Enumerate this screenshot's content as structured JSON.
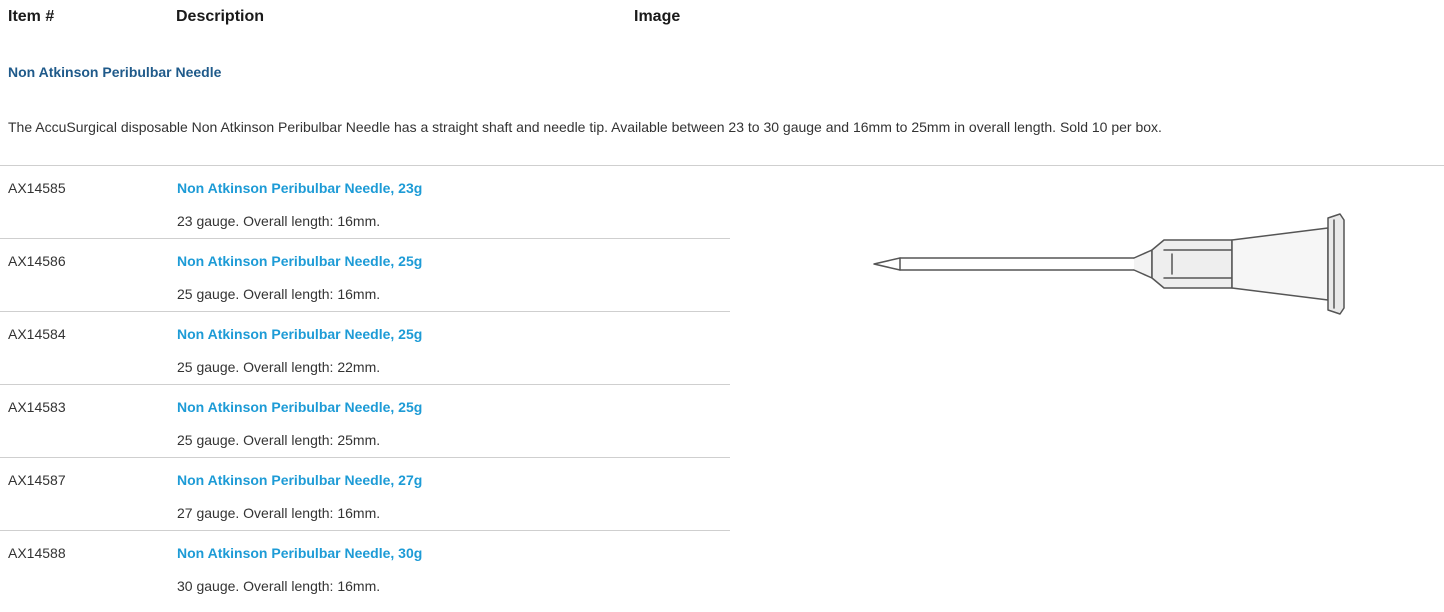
{
  "table": {
    "headers": {
      "item": "Item #",
      "description": "Description",
      "image": "Image"
    }
  },
  "section": {
    "title": "Non Atkinson Peribulbar Needle",
    "description": "The AccuSurgical disposable Non Atkinson Peribulbar Needle has a straight shaft and needle tip. Available between 23 to 30 gauge and 16mm to 25mm in overall length. Sold 10 per box."
  },
  "items": [
    {
      "code": "AX14585",
      "name": "Non Atkinson Peribulbar Needle, 23g",
      "spec": "23 gauge. Overall length: 16mm."
    },
    {
      "code": "AX14586",
      "name": "Non Atkinson Peribulbar Needle, 25g",
      "spec": "25 gauge. Overall length: 16mm."
    },
    {
      "code": "AX14584",
      "name": "Non Atkinson Peribulbar Needle, 25g",
      "spec": "25 gauge. Overall length: 22mm."
    },
    {
      "code": "AX14583",
      "name": "Non Atkinson Peribulbar Needle, 25g",
      "spec": "25 gauge. Overall length: 25mm."
    },
    {
      "code": "AX14587",
      "name": "Non Atkinson Peribulbar Needle, 27g",
      "spec": "27 gauge. Overall length: 16mm."
    },
    {
      "code": "AX14588",
      "name": "Non Atkinson Peribulbar Needle, 30g",
      "spec": "30 gauge. Overall length: 16mm."
    }
  ],
  "colors": {
    "section_title": "#1f5a8a",
    "item_link": "#1d9bd6",
    "divider": "#cfcfcf"
  },
  "image": {
    "icon": "needle-illustration"
  }
}
